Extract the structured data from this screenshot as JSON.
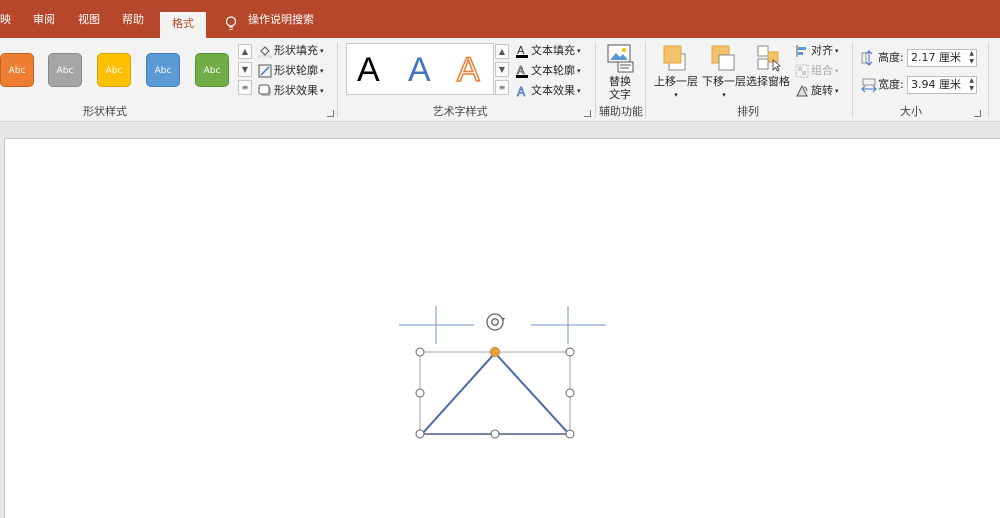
{
  "tabs": [
    {
      "label": "映"
    },
    {
      "label": "审阅"
    },
    {
      "label": "视图"
    },
    {
      "label": "帮助"
    },
    {
      "label": "格式"
    }
  ],
  "tell_me": "操作说明搜索",
  "shape_styles": {
    "group_label": "形状样式",
    "swatches": [
      {
        "text": "Abc",
        "color": "#ed7d31"
      },
      {
        "text": "Abc",
        "color": "#a5a5a5"
      },
      {
        "text": "Abc",
        "color": "#ffc000"
      },
      {
        "text": "Abc",
        "color": "#5b9bd5"
      },
      {
        "text": "Abc",
        "color": "#70ad47"
      }
    ],
    "fill": "形状填充",
    "outline": "形状轮廓",
    "effects": "形状效果"
  },
  "wordart": {
    "group_label": "艺术字样式",
    "samples": [
      {
        "text": "A",
        "color": "#000000"
      },
      {
        "text": "A",
        "color": "#4472c4"
      },
      {
        "text": "A",
        "color": "#ed7d31"
      }
    ],
    "text_fill": "文本填充",
    "text_outline": "文本轮廓",
    "text_effects": "文本效果"
  },
  "accessibility": {
    "group_label": "辅助功能",
    "alt_text_line1": "替换",
    "alt_text_line2": "文字"
  },
  "arrange": {
    "group_label": "排列",
    "bring_forward": "上移一层",
    "send_backward": "下移一层",
    "selection_pane": "选择窗格",
    "align": "对齐",
    "group": "组合",
    "rotate": "旋转"
  },
  "size": {
    "group_label": "大小",
    "height_label": "高度:",
    "height_value": "2.17 厘米",
    "width_label": "宽度:",
    "width_value": "3.94 厘米"
  },
  "colors": {
    "accent": "#b7472a",
    "shape_stroke": "#4a68a8",
    "adjust_handle": "#e8a33c"
  }
}
